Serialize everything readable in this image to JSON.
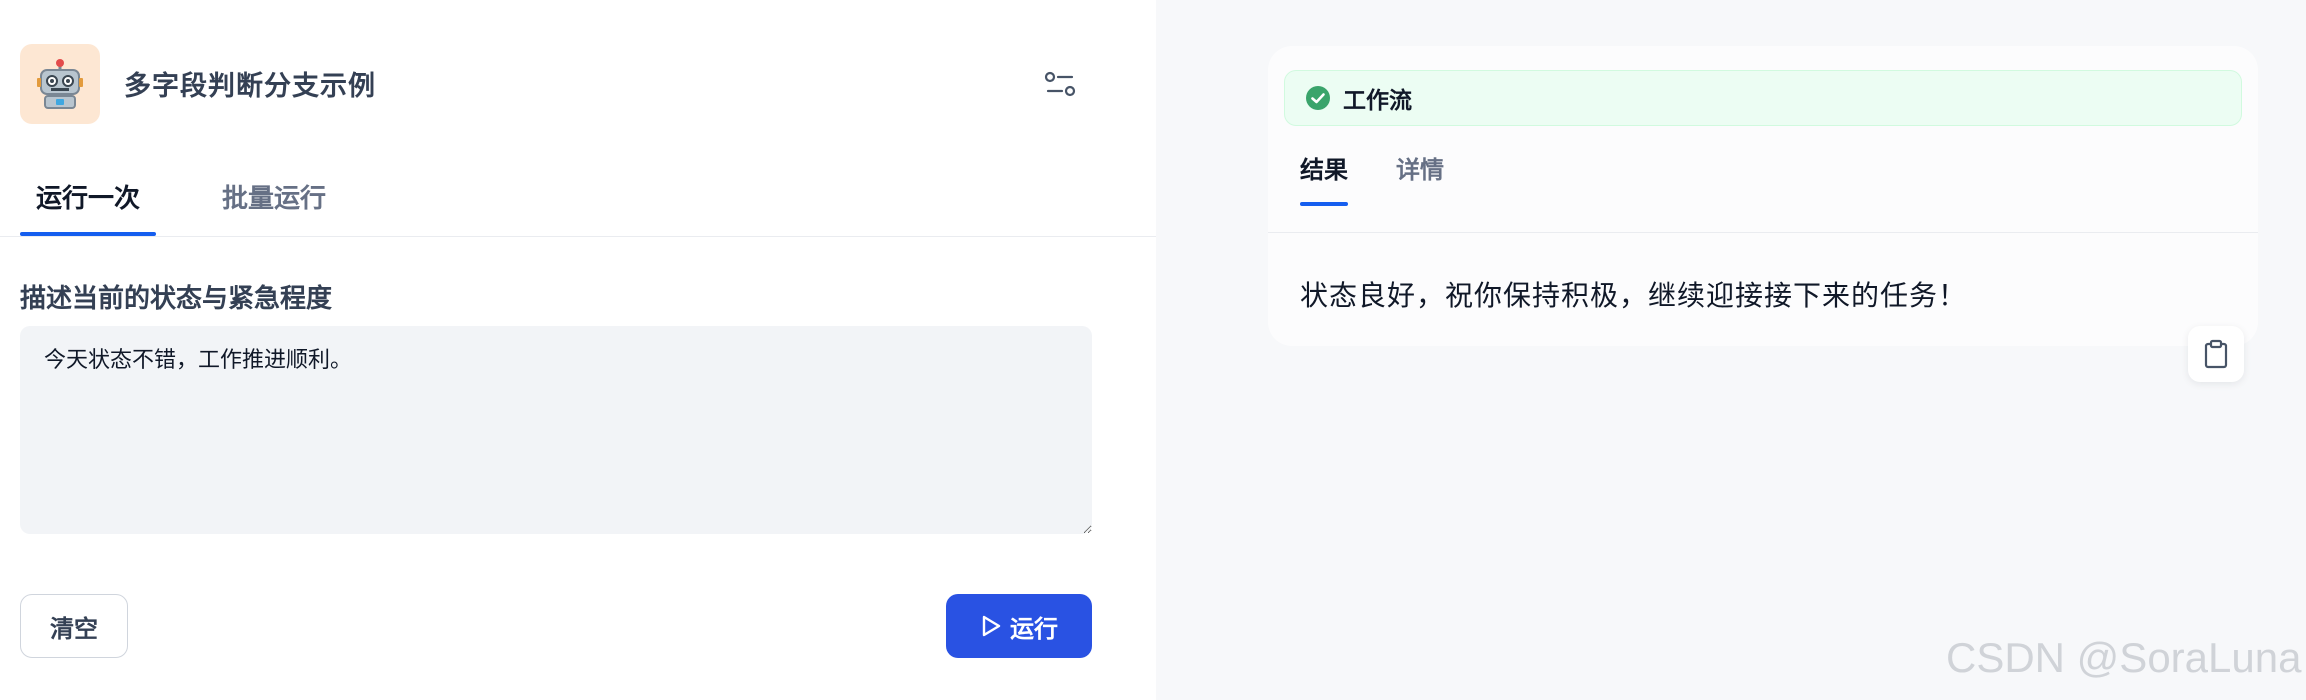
{
  "app": {
    "title": "多字段判断分支示例",
    "icon": "robot-icon"
  },
  "tabs": [
    {
      "label": "运行一次",
      "active": true
    },
    {
      "label": "批量运行",
      "active": false
    }
  ],
  "form": {
    "field_label": "描述当前的状态与紧急程度",
    "field_value": "今天状态不错，工作推进顺利。",
    "clear_label": "清空",
    "run_label": "运行"
  },
  "result": {
    "workflow_label": "工作流",
    "workflow_status": "success",
    "tabs": [
      {
        "label": "结果",
        "active": true
      },
      {
        "label": "详情",
        "active": false
      }
    ],
    "output": "状态良好，祝你保持积极，继续迎接接下来的任务！"
  },
  "watermark": "CSDN @SoraLuna",
  "colors": {
    "accent": "#155eef",
    "run_button": "#2952e3",
    "success": "#3aa46b",
    "app_icon_bg": "#fde7d3"
  }
}
